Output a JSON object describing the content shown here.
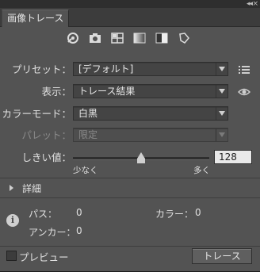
{
  "panel": {
    "tab_label": "画像トレース",
    "collapse_glyph": "◂◂",
    "close_glyph": "×"
  },
  "preset_buttons": [
    "auto-color-icon",
    "high-color-icon",
    "low-color-icon",
    "grayscale-icon",
    "black-white-icon",
    "outline-icon"
  ],
  "fields": {
    "preset_label": "プリセット：",
    "preset_value": "[デフォルト]",
    "view_label": "表示：",
    "view_value": "トレース結果",
    "mode_label": "カラーモード：",
    "mode_value": "白黒",
    "palette_label": "パレット：",
    "palette_value": "限定"
  },
  "threshold": {
    "label": "しきい値：",
    "value": "128",
    "min_label": "少なく",
    "max_label": "多く",
    "fraction": 0.5
  },
  "details": {
    "label": "詳細"
  },
  "stats": {
    "paths_label": "パス：",
    "paths_value": "0",
    "colors_label": "カラー：",
    "colors_value": "0",
    "anchors_label": "アンカー：",
    "anchors_value": "0"
  },
  "bottom": {
    "preview_label": "プレビュー",
    "trace_button_label": "トレース"
  }
}
